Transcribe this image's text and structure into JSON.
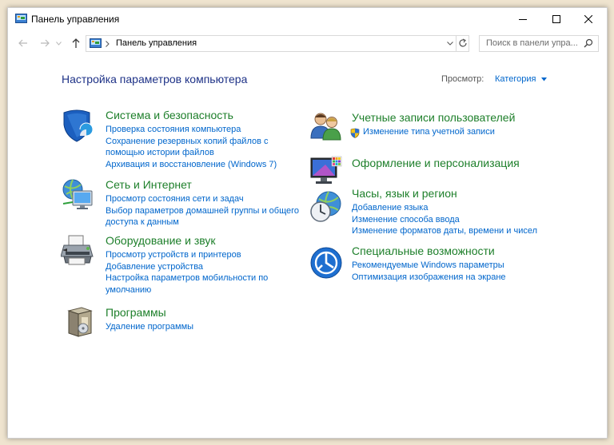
{
  "window": {
    "title": "Панель управления"
  },
  "address": {
    "crumb": "Панель управления",
    "search_placeholder": "Поиск в панели упра..."
  },
  "header": {
    "heading": "Настройка параметров компьютера",
    "view_label": "Просмотр:",
    "view_value": "Категория"
  },
  "categories": [
    {
      "title": "Система и безопасность",
      "icon": "shield-icon",
      "links": [
        "Проверка состояния компьютера",
        "Сохранение резервных копий файлов с",
        "помощью истории файлов",
        "Архивация и восстановление (Windows 7)"
      ]
    },
    {
      "title": "Сеть и Интернет",
      "icon": "network-globe-icon",
      "links": [
        "Просмотр состояния сети и задач",
        "Выбор параметров домашней группы и общего",
        "доступа к данным"
      ]
    },
    {
      "title": "Оборудование и звук",
      "icon": "printer-icon",
      "links": [
        "Просмотр устройств и принтеров",
        "Добавление устройства",
        "Настройка параметров мобильности по",
        "умолчанию"
      ]
    },
    {
      "title": "Программы",
      "icon": "programs-box-icon",
      "links": [
        "Удаление программы"
      ]
    },
    {
      "title": "Учетные записи пользователей",
      "icon": "users-icon",
      "links": [
        "Изменение типа учетной записи"
      ]
    },
    {
      "title": "Оформление и персонализация",
      "icon": "personalization-icon",
      "links": []
    },
    {
      "title": "Часы, язык и регион",
      "icon": "clock-globe-icon",
      "links": [
        "Добавление языка",
        "Изменение способа ввода",
        "Изменение форматов даты, времени и чисел"
      ]
    },
    {
      "title": "Специальные возможности",
      "icon": "accessibility-icon",
      "links": [
        "Рекомендуемые Windows параметры",
        "Оптимизация изображения на экране"
      ]
    }
  ],
  "colors": {
    "heading": "#1e3287",
    "category_title": "#1d7f2a",
    "link": "#0066cc"
  }
}
